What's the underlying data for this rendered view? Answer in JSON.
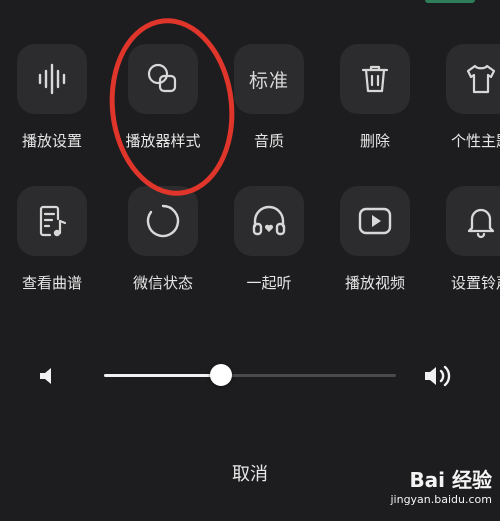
{
  "row1": [
    {
      "label": "播放设置",
      "icon": "waveform-icon"
    },
    {
      "label": "播放器样式",
      "icon": "overlap-squares-icon"
    },
    {
      "label": "音质",
      "icon": "text-badge",
      "icon_text": "标准"
    },
    {
      "label": "删除",
      "icon": "trash-icon"
    },
    {
      "label": "个性主题",
      "icon": "tshirt-icon"
    }
  ],
  "row2": [
    {
      "label": "查看曲谱",
      "icon": "sheet-music-icon"
    },
    {
      "label": "微信状态",
      "icon": "circle-ring-icon"
    },
    {
      "label": "一起听",
      "icon": "headphones-heart-icon"
    },
    {
      "label": "播放视频",
      "icon": "play-video-icon"
    },
    {
      "label": "设置铃声",
      "icon": "bell-icon"
    }
  ],
  "volume": {
    "level": 0.4,
    "low_icon": "volume-low-icon",
    "high_icon": "volume-high-icon"
  },
  "cancel_label": "取消",
  "watermark": {
    "logo_text": "Bai  经验",
    "url": "jingyan.baidu.com"
  },
  "colors": {
    "background": "#1d1d1f",
    "tile": "#2c2c2e",
    "highlight": "#e0352b",
    "accent": "#2e7d5b"
  }
}
